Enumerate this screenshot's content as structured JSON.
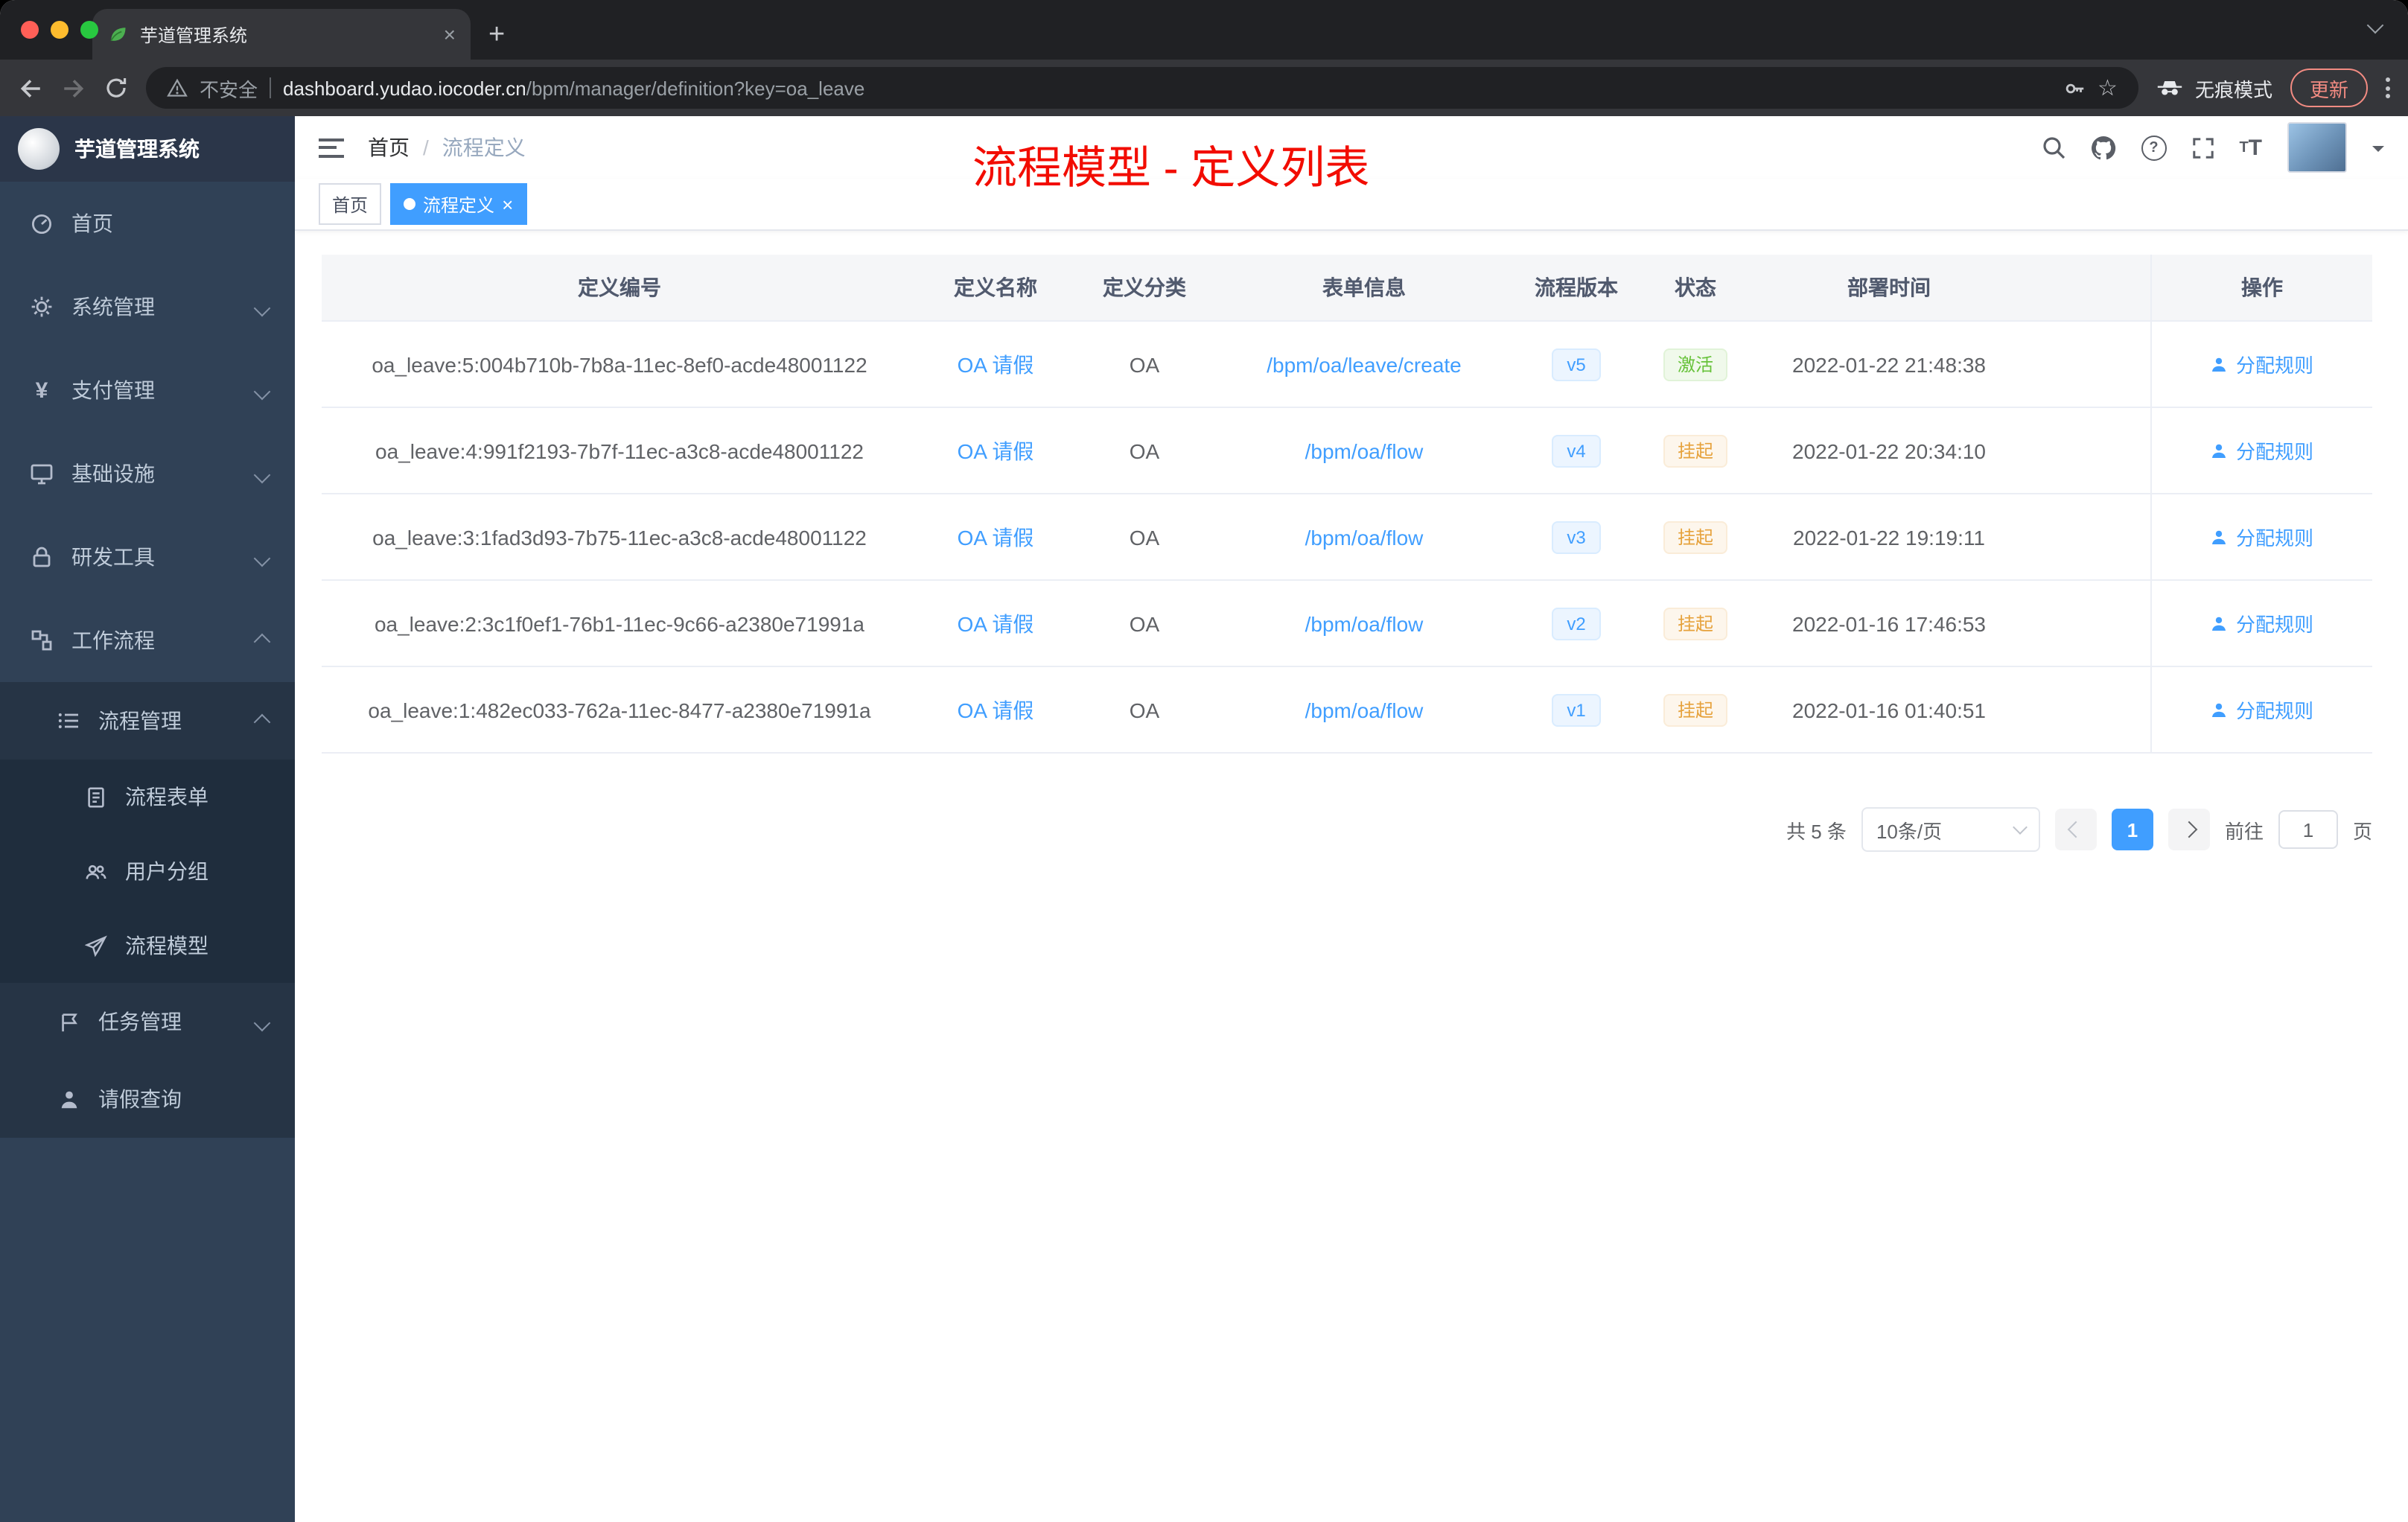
{
  "browser": {
    "tab_title": "芋道管理系统",
    "not_secure": "不安全",
    "url_host": "dashboard.yudao.iocoder.cn",
    "url_path": "/bpm/manager/definition?key=oa_leave",
    "incognito_label": "无痕模式",
    "update_label": "更新"
  },
  "glyphs": {
    "close": "×",
    "plus": "+",
    "question": "?",
    "star": "☆",
    "separator": "/",
    "yen": "¥",
    "font_t_big": "T",
    "font_t_small": "T"
  },
  "sidebar": {
    "logo_title": "芋道管理系统",
    "items": [
      {
        "label": "首页"
      },
      {
        "label": "系统管理"
      },
      {
        "label": "支付管理"
      },
      {
        "label": "基础设施"
      },
      {
        "label": "研发工具"
      },
      {
        "label": "工作流程"
      },
      {
        "label": "流程管理"
      },
      {
        "label": "流程表单"
      },
      {
        "label": "用户分组"
      },
      {
        "label": "流程模型"
      },
      {
        "label": "任务管理"
      },
      {
        "label": "请假查询"
      }
    ]
  },
  "navbar": {
    "breadcrumb_home": "首页",
    "breadcrumb_current": "流程定义"
  },
  "annotation": "流程模型 - 定义列表",
  "tags": {
    "home": "首页",
    "active": "流程定义"
  },
  "table": {
    "columns": [
      "定义编号",
      "定义名称",
      "定义分类",
      "表单信息",
      "流程版本",
      "状态",
      "部署时间",
      "操作"
    ],
    "action_label": "分配规则",
    "rows": [
      {
        "id": "oa_leave:5:004b710b-7b8a-11ec-8ef0-acde48001122",
        "name": "OA 请假",
        "category": "OA",
        "form": "/bpm/oa/leave/create",
        "version": "v5",
        "status": "激活",
        "time": "2022-01-22 21:48:38"
      },
      {
        "id": "oa_leave:4:991f2193-7b7f-11ec-a3c8-acde48001122",
        "name": "OA 请假",
        "category": "OA",
        "form": "/bpm/oa/flow",
        "version": "v4",
        "status": "挂起",
        "time": "2022-01-22 20:34:10"
      },
      {
        "id": "oa_leave:3:1fad3d93-7b75-11ec-a3c8-acde48001122",
        "name": "OA 请假",
        "category": "OA",
        "form": "/bpm/oa/flow",
        "version": "v3",
        "status": "挂起",
        "time": "2022-01-22 19:19:11"
      },
      {
        "id": "oa_leave:2:3c1f0ef1-76b1-11ec-9c66-a2380e71991a",
        "name": "OA 请假",
        "category": "OA",
        "form": "/bpm/oa/flow",
        "version": "v2",
        "status": "挂起",
        "time": "2022-01-16 17:46:53"
      },
      {
        "id": "oa_leave:1:482ec033-762a-11ec-8477-a2380e71991a",
        "name": "OA 请假",
        "category": "OA",
        "form": "/bpm/oa/flow",
        "version": "v1",
        "status": "挂起",
        "time": "2022-01-16 01:40:51"
      }
    ]
  },
  "pagination": {
    "total": "共 5 条",
    "page_size": "10条/页",
    "current_page": "1",
    "goto_label": "前往",
    "goto_value": "1",
    "page_unit": "页"
  },
  "colors": {
    "accent": "#409eff",
    "success": "#67c23a",
    "warning": "#e6a23c",
    "annotation_red": "#f20c00",
    "sidebar_bg": "#304156",
    "sidebar_submenu_bg": "#263445",
    "sidebar_subsubmenu_bg": "#1f2d3d",
    "tag_active_bg": "#409eff"
  }
}
